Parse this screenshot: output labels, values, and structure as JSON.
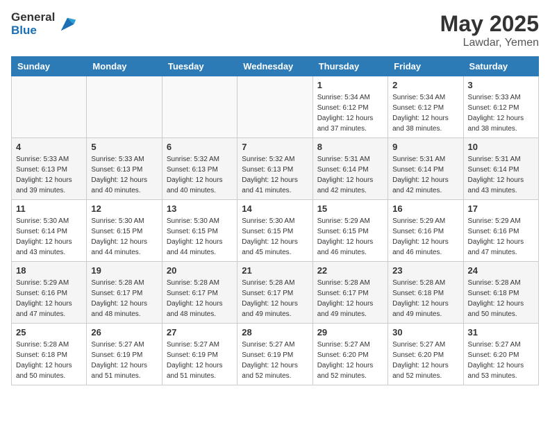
{
  "header": {
    "logo_general": "General",
    "logo_blue": "Blue",
    "title": "May 2025",
    "location": "Lawdar, Yemen"
  },
  "weekdays": [
    "Sunday",
    "Monday",
    "Tuesday",
    "Wednesday",
    "Thursday",
    "Friday",
    "Saturday"
  ],
  "weeks": [
    [
      {
        "day": "",
        "info": ""
      },
      {
        "day": "",
        "info": ""
      },
      {
        "day": "",
        "info": ""
      },
      {
        "day": "",
        "info": ""
      },
      {
        "day": "1",
        "info": "Sunrise: 5:34 AM\nSunset: 6:12 PM\nDaylight: 12 hours\nand 37 minutes."
      },
      {
        "day": "2",
        "info": "Sunrise: 5:34 AM\nSunset: 6:12 PM\nDaylight: 12 hours\nand 38 minutes."
      },
      {
        "day": "3",
        "info": "Sunrise: 5:33 AM\nSunset: 6:12 PM\nDaylight: 12 hours\nand 38 minutes."
      }
    ],
    [
      {
        "day": "4",
        "info": "Sunrise: 5:33 AM\nSunset: 6:13 PM\nDaylight: 12 hours\nand 39 minutes."
      },
      {
        "day": "5",
        "info": "Sunrise: 5:33 AM\nSunset: 6:13 PM\nDaylight: 12 hours\nand 40 minutes."
      },
      {
        "day": "6",
        "info": "Sunrise: 5:32 AM\nSunset: 6:13 PM\nDaylight: 12 hours\nand 40 minutes."
      },
      {
        "day": "7",
        "info": "Sunrise: 5:32 AM\nSunset: 6:13 PM\nDaylight: 12 hours\nand 41 minutes."
      },
      {
        "day": "8",
        "info": "Sunrise: 5:31 AM\nSunset: 6:14 PM\nDaylight: 12 hours\nand 42 minutes."
      },
      {
        "day": "9",
        "info": "Sunrise: 5:31 AM\nSunset: 6:14 PM\nDaylight: 12 hours\nand 42 minutes."
      },
      {
        "day": "10",
        "info": "Sunrise: 5:31 AM\nSunset: 6:14 PM\nDaylight: 12 hours\nand 43 minutes."
      }
    ],
    [
      {
        "day": "11",
        "info": "Sunrise: 5:30 AM\nSunset: 6:14 PM\nDaylight: 12 hours\nand 43 minutes."
      },
      {
        "day": "12",
        "info": "Sunrise: 5:30 AM\nSunset: 6:15 PM\nDaylight: 12 hours\nand 44 minutes."
      },
      {
        "day": "13",
        "info": "Sunrise: 5:30 AM\nSunset: 6:15 PM\nDaylight: 12 hours\nand 44 minutes."
      },
      {
        "day": "14",
        "info": "Sunrise: 5:30 AM\nSunset: 6:15 PM\nDaylight: 12 hours\nand 45 minutes."
      },
      {
        "day": "15",
        "info": "Sunrise: 5:29 AM\nSunset: 6:15 PM\nDaylight: 12 hours\nand 46 minutes."
      },
      {
        "day": "16",
        "info": "Sunrise: 5:29 AM\nSunset: 6:16 PM\nDaylight: 12 hours\nand 46 minutes."
      },
      {
        "day": "17",
        "info": "Sunrise: 5:29 AM\nSunset: 6:16 PM\nDaylight: 12 hours\nand 47 minutes."
      }
    ],
    [
      {
        "day": "18",
        "info": "Sunrise: 5:29 AM\nSunset: 6:16 PM\nDaylight: 12 hours\nand 47 minutes."
      },
      {
        "day": "19",
        "info": "Sunrise: 5:28 AM\nSunset: 6:17 PM\nDaylight: 12 hours\nand 48 minutes."
      },
      {
        "day": "20",
        "info": "Sunrise: 5:28 AM\nSunset: 6:17 PM\nDaylight: 12 hours\nand 48 minutes."
      },
      {
        "day": "21",
        "info": "Sunrise: 5:28 AM\nSunset: 6:17 PM\nDaylight: 12 hours\nand 49 minutes."
      },
      {
        "day": "22",
        "info": "Sunrise: 5:28 AM\nSunset: 6:17 PM\nDaylight: 12 hours\nand 49 minutes."
      },
      {
        "day": "23",
        "info": "Sunrise: 5:28 AM\nSunset: 6:18 PM\nDaylight: 12 hours\nand 49 minutes."
      },
      {
        "day": "24",
        "info": "Sunrise: 5:28 AM\nSunset: 6:18 PM\nDaylight: 12 hours\nand 50 minutes."
      }
    ],
    [
      {
        "day": "25",
        "info": "Sunrise: 5:28 AM\nSunset: 6:18 PM\nDaylight: 12 hours\nand 50 minutes."
      },
      {
        "day": "26",
        "info": "Sunrise: 5:27 AM\nSunset: 6:19 PM\nDaylight: 12 hours\nand 51 minutes."
      },
      {
        "day": "27",
        "info": "Sunrise: 5:27 AM\nSunset: 6:19 PM\nDaylight: 12 hours\nand 51 minutes."
      },
      {
        "day": "28",
        "info": "Sunrise: 5:27 AM\nSunset: 6:19 PM\nDaylight: 12 hours\nand 52 minutes."
      },
      {
        "day": "29",
        "info": "Sunrise: 5:27 AM\nSunset: 6:20 PM\nDaylight: 12 hours\nand 52 minutes."
      },
      {
        "day": "30",
        "info": "Sunrise: 5:27 AM\nSunset: 6:20 PM\nDaylight: 12 hours\nand 52 minutes."
      },
      {
        "day": "31",
        "info": "Sunrise: 5:27 AM\nSunset: 6:20 PM\nDaylight: 12 hours\nand 53 minutes."
      }
    ]
  ]
}
